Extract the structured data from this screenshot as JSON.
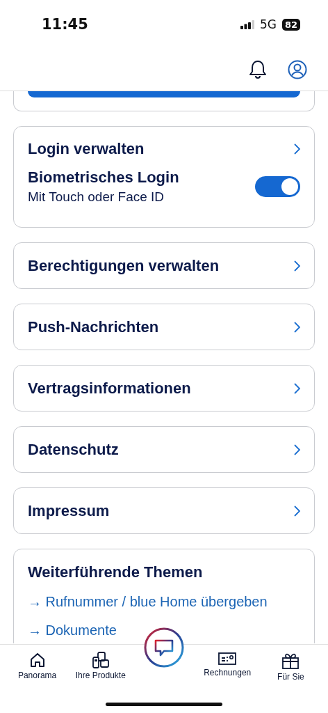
{
  "status_bar": {
    "time": "11:45",
    "network": "5G",
    "battery": "82"
  },
  "login_card": {
    "title": "Login verwalten",
    "biometric": {
      "title": "Biometrisches Login",
      "subtitle": "Mit Touch oder Face ID",
      "on": true
    }
  },
  "menu_items": [
    "Berechtigungen verwalten",
    "Push-Nachrichten",
    "Vertragsinformationen",
    "Datenschutz",
    "Impressum"
  ],
  "related": {
    "title": "Weiterführende Themen",
    "links": [
      {
        "arrow": "→",
        "label": "Rufnummer / blue Home übergeben"
      },
      {
        "arrow": "→",
        "label": "Dokumente"
      }
    ]
  },
  "tab_bar": [
    {
      "kind": "home",
      "label": "Panorama"
    },
    {
      "kind": "devices",
      "label": "Ihre Produkte"
    },
    {
      "kind": "chat"
    },
    {
      "kind": "bill",
      "label": "Rechnungen"
    },
    {
      "kind": "gift",
      "label": "Für Sie"
    }
  ]
}
